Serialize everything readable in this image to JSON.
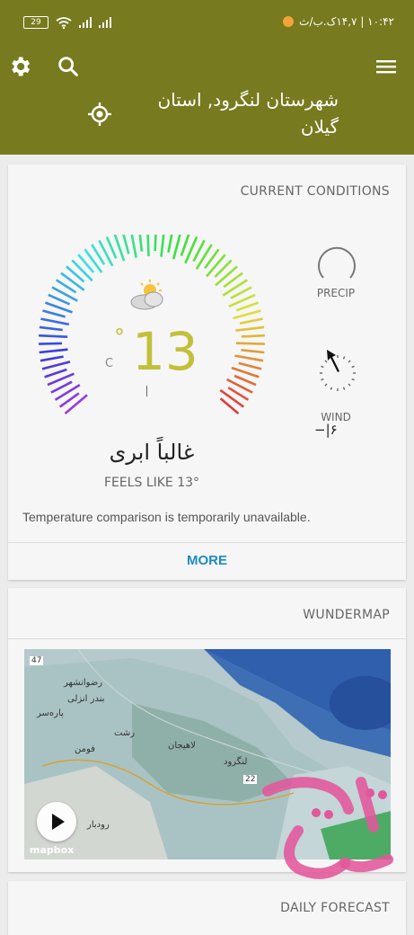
{
  "status": {
    "battery": "29",
    "time": "۱۰:۴۲ | ۱۴,۷ک.ب/ث"
  },
  "header": {
    "location": "شهرستان لنگرود, استان گیلان",
    "icons": [
      "gear-icon",
      "search-icon",
      "menu-icon",
      "locate-icon"
    ]
  },
  "current": {
    "title": "CURRENT CONDITIONS",
    "temp_deg": "°",
    "temperature": "13",
    "unit": "C",
    "condition": "غالباً ابری",
    "feels_like": "FEELS LIKE 13°",
    "temperature_value": 13,
    "precip_label": "PRECIP",
    "wind_label": "WIND",
    "wind_value": "−|۶",
    "comparison": "Temperature comparison is temporarily unavailable.",
    "more": "MORE",
    "colors": {
      "accent": "#c2c03a",
      "link": "#1e8bc3",
      "header": "#777a1e"
    }
  },
  "wundermap": {
    "title": "WUNDERMAP",
    "mapbox": "mapbox",
    "badge": "47",
    "road_number": "22",
    "labels": {
      "l1": "رضوانشهر",
      "l2": "بندر انزلی",
      "l3": "پاره‌سر",
      "l4": "رشت",
      "l5": "فومن",
      "l6": "لاهیجان",
      "l7": "لنگرود",
      "l8": "رودبار"
    }
  },
  "daily": {
    "title": "DAILY FORECAST"
  }
}
